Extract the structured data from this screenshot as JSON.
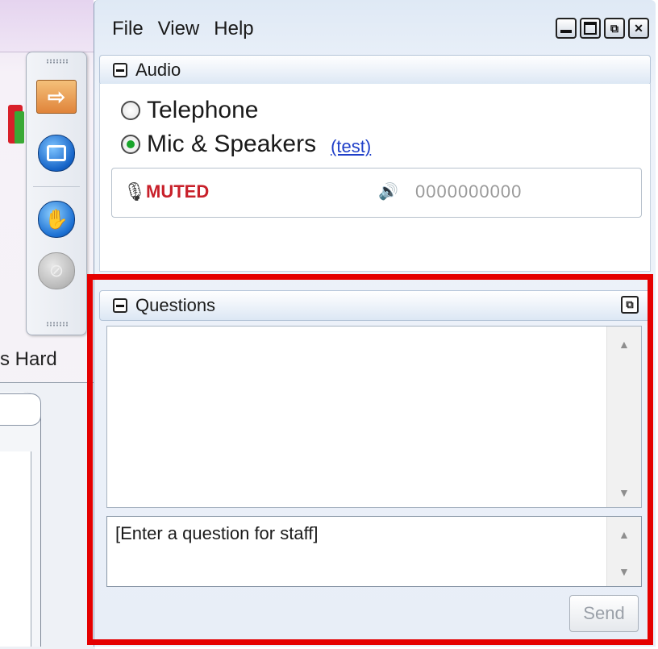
{
  "background_app": {
    "partial_text": "s Hard"
  },
  "menu": {
    "file": "File",
    "view": "View",
    "help": "Help"
  },
  "audio": {
    "title": "Audio",
    "option_telephone": "Telephone",
    "option_mic": "Mic & Speakers",
    "selected": "Mic & Speakers",
    "test_link": "(test)",
    "mute_status": "MUTED",
    "level_readout": "0000000000"
  },
  "questions": {
    "title": "Questions",
    "input_text": "[Enter a question for staff]",
    "send_label": "Send"
  },
  "colors": {
    "muted": "#c8202a",
    "highlight_frame": "#e50000",
    "selected_radio": "#18a52a",
    "link": "#1f3fc8"
  }
}
